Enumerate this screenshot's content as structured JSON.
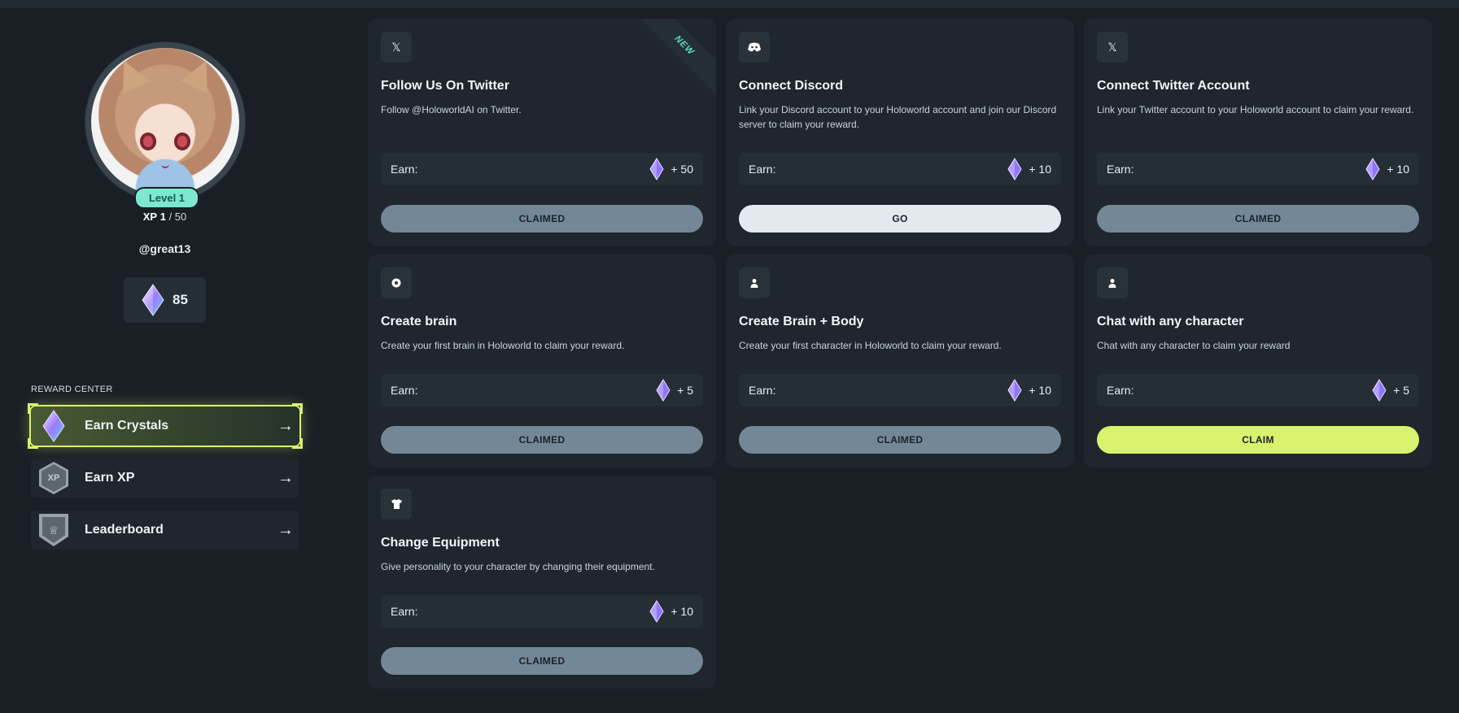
{
  "profile": {
    "level_label": "Level 1",
    "xp_prefix": "XP",
    "xp_current": "1",
    "xp_max": "/ 50",
    "username": "@great13",
    "crystals": "85"
  },
  "sidebar": {
    "section_label": "REWARD CENTER",
    "items": [
      {
        "label": "Earn Crystals",
        "icon": "crystal-icon",
        "active": true
      },
      {
        "label": "Earn XP",
        "icon": "xp-badge-icon",
        "active": false
      },
      {
        "label": "Leaderboard",
        "icon": "crown-shield-icon",
        "active": false
      }
    ]
  },
  "earn_label": "Earn:",
  "new_badge": "NEW",
  "tasks": [
    {
      "icon": "x-logo-icon",
      "title": "Follow Us On Twitter",
      "description": "Follow @HoloworldAI on Twitter.",
      "reward": "+ 50",
      "button": "CLAIMED",
      "is_new": true
    },
    {
      "icon": "discord-icon",
      "title": "Connect Discord",
      "description": "Link your Discord account to your Holoworld account and join our Discord server to claim your reward.",
      "reward": "+ 10",
      "button": "GO"
    },
    {
      "icon": "x-logo-icon",
      "title": "Connect Twitter Account",
      "description": "Link your Twitter account to your Holoworld account to claim your reward.",
      "reward": "+ 10",
      "button": "CLAIMED"
    },
    {
      "icon": "brain-icon",
      "title": "Create brain",
      "description": "Create your first brain in Holoworld to claim your reward.",
      "reward": "+ 5",
      "button": "CLAIMED"
    },
    {
      "icon": "character-icon",
      "title": "Create Brain + Body",
      "description": "Create your first character in Holoworld to claim your reward.",
      "reward": "+ 10",
      "button": "CLAIMED"
    },
    {
      "icon": "character-icon",
      "title": "Chat with any character",
      "description": "Chat with any character to claim your reward",
      "reward": "+ 5",
      "button": "CLAIM"
    },
    {
      "icon": "shirt-icon",
      "title": "Change Equipment",
      "description": "Give personality to your character by changing their equipment.",
      "reward": "+ 10",
      "button": "CLAIMED"
    }
  ],
  "colors": {
    "background": "#1a1f25",
    "card": "#1f262d",
    "accent": "#d9f26d",
    "claimed": "#748797",
    "level_badge": "#7ce8cd"
  }
}
